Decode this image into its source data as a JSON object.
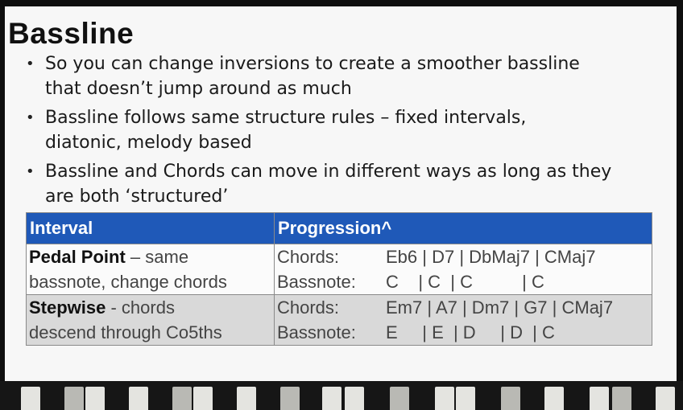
{
  "slide": {
    "title": "Bassline",
    "bullets": [
      {
        "line1": "So you can change inversions to create a smoother bassline",
        "line2": "that doesn’t jump around as much"
      },
      {
        "line1": "Bassline follows same structure rules – fixed intervals,",
        "line2": "diatonic, melody based"
      },
      {
        "line1": "Bassline and Chords can move in different ways as long as they",
        "line2": "are both ‘structured’"
      }
    ],
    "bullet_glyph": "•",
    "table": {
      "header_color": "#1f59b8",
      "headers": [
        "Interval",
        "Progression^"
      ],
      "rows": [
        {
          "name": "Pedal Point",
          "desc1": " – same",
          "desc2": "bassnote, change chords",
          "chords_label": "Chords:",
          "chords": "Eb6 | D7 | DbMaj7 | CMaj7",
          "bass_label": "Bassnote:",
          "bass": "C    | C  | C          | C"
        },
        {
          "name": "Stepwise",
          "desc1": " - chords",
          "desc2": "descend through Co5ths",
          "chords_label": "Chords:",
          "chords": "Em7 | A7 | Dm7 | G7 | CMaj7",
          "bass_label": "Bassnote:",
          "bass": "E     | E  | D     | D  | C"
        }
      ]
    }
  },
  "background": {
    "piano_keys": "piano-keys"
  }
}
